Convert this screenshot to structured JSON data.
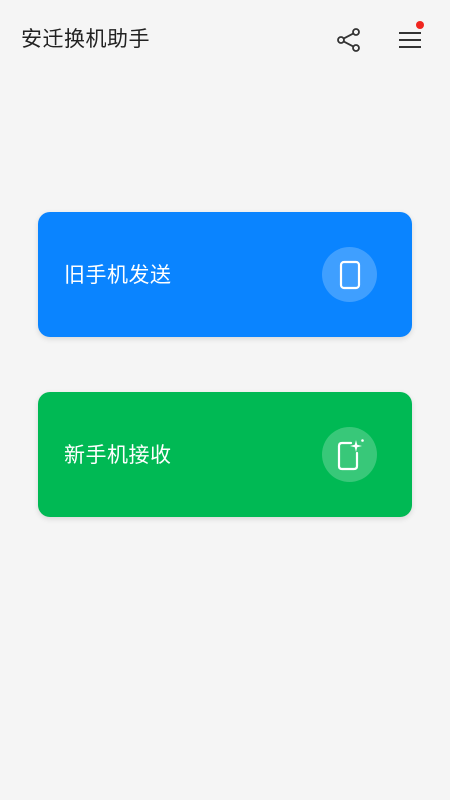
{
  "header": {
    "title": "安迁换机助手",
    "share_icon": "share-icon",
    "menu_icon": "menu-icon",
    "notification_dot_color": "#f0251f"
  },
  "cards": {
    "send": {
      "label": "旧手机发送",
      "color": "#0a84ff",
      "icon": "phone-icon"
    },
    "receive": {
      "label": "新手机接收",
      "color": "#00b954",
      "icon": "new-phone-sparkle-icon"
    }
  }
}
